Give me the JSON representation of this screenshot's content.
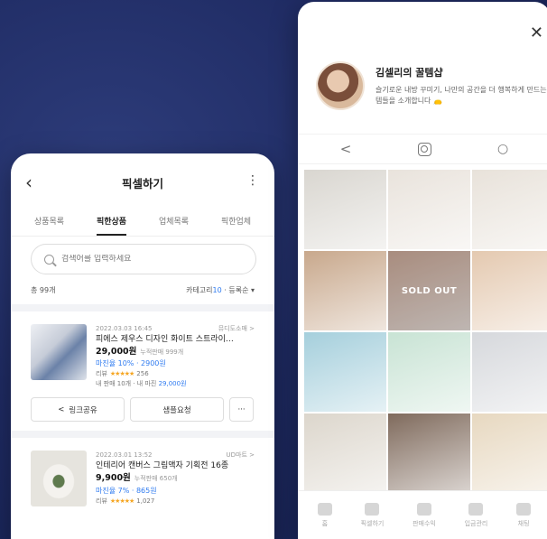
{
  "left_phone": {
    "header": {
      "back_icon": "chevron-left-icon",
      "title": "픽셀하기",
      "more_icon": "more-vertical-icon"
    },
    "tabs": [
      {
        "label": "상품목록",
        "active": false
      },
      {
        "label": "픽한상품",
        "active": true
      },
      {
        "label": "업체목록",
        "active": false
      },
      {
        "label": "픽한업체",
        "active": false
      }
    ],
    "search": {
      "placeholder": "검색어를 입력하세요"
    },
    "count_label": "총 99개",
    "sort": {
      "category_label": "카테고리",
      "category_count": "10",
      "rest": " · 등록순",
      "chevron": "▾"
    },
    "products": [
      {
        "date": "2022.03.03 16:45",
        "seller": "뮤디도소매 >",
        "name": "피에스 제우스 디자인 화이트 스트라이…",
        "price": "29,000원",
        "sales": "누적판매 999개",
        "margin": "마진율 10% · 2900원",
        "review_label": "리뷰",
        "stars": "★★★★★",
        "review_count": "256",
        "my_sales": "내 판매 10개 · 내 마진 ",
        "my_margin": "29,000원",
        "thumb_color": "#d8dde6"
      },
      {
        "date": "2022.03.01 13:52",
        "seller": "UD마트 >",
        "name": "인테리어 캔버스 그림액자 기획전 16종",
        "price": "9,900원",
        "sales": "누적판매 650개",
        "margin": "마진율 7% · 865원",
        "review_label": "리뷰",
        "stars": "★★★★★",
        "review_count": "1,027",
        "thumb_color": "#e6e4de"
      }
    ],
    "buttons": {
      "share": "링크공유",
      "sample": "샘플요청",
      "more": "···"
    }
  },
  "right_phone": {
    "close_icon": "close-icon",
    "profile": {
      "name": "김셀리의 꿀템샵",
      "desc": "슬기로운 내방 꾸미기, 나만의 공간을 더 행복하게 만드는 꿀템들을 소개합니다 👝"
    },
    "social_icons": [
      "share-icon",
      "instagram-icon",
      "search-icon"
    ],
    "grid": [
      {
        "color": "#d9d6d0",
        "label": ""
      },
      {
        "color": "#e9e3dc",
        "label": ""
      },
      {
        "color": "#e8e2da",
        "label": ""
      },
      {
        "color": "#c8a88c",
        "label": ""
      },
      {
        "color": "#d8b4a2",
        "label": "SOLD OUT"
      },
      {
        "color": "#e4c9b0",
        "label": ""
      },
      {
        "color": "#a5cfdc",
        "label": ""
      },
      {
        "color": "#c8e3d4",
        "label": ""
      },
      {
        "color": "#d6d8dc",
        "label": ""
      },
      {
        "color": "#dcd6cc",
        "label": ""
      },
      {
        "color": "#7f6a5c",
        "label": ""
      },
      {
        "color": "#e7d8c0",
        "label": ""
      }
    ],
    "bottom_nav": [
      "홈",
      "픽셀하기",
      "판매수익",
      "입금관리",
      "채팅"
    ]
  }
}
